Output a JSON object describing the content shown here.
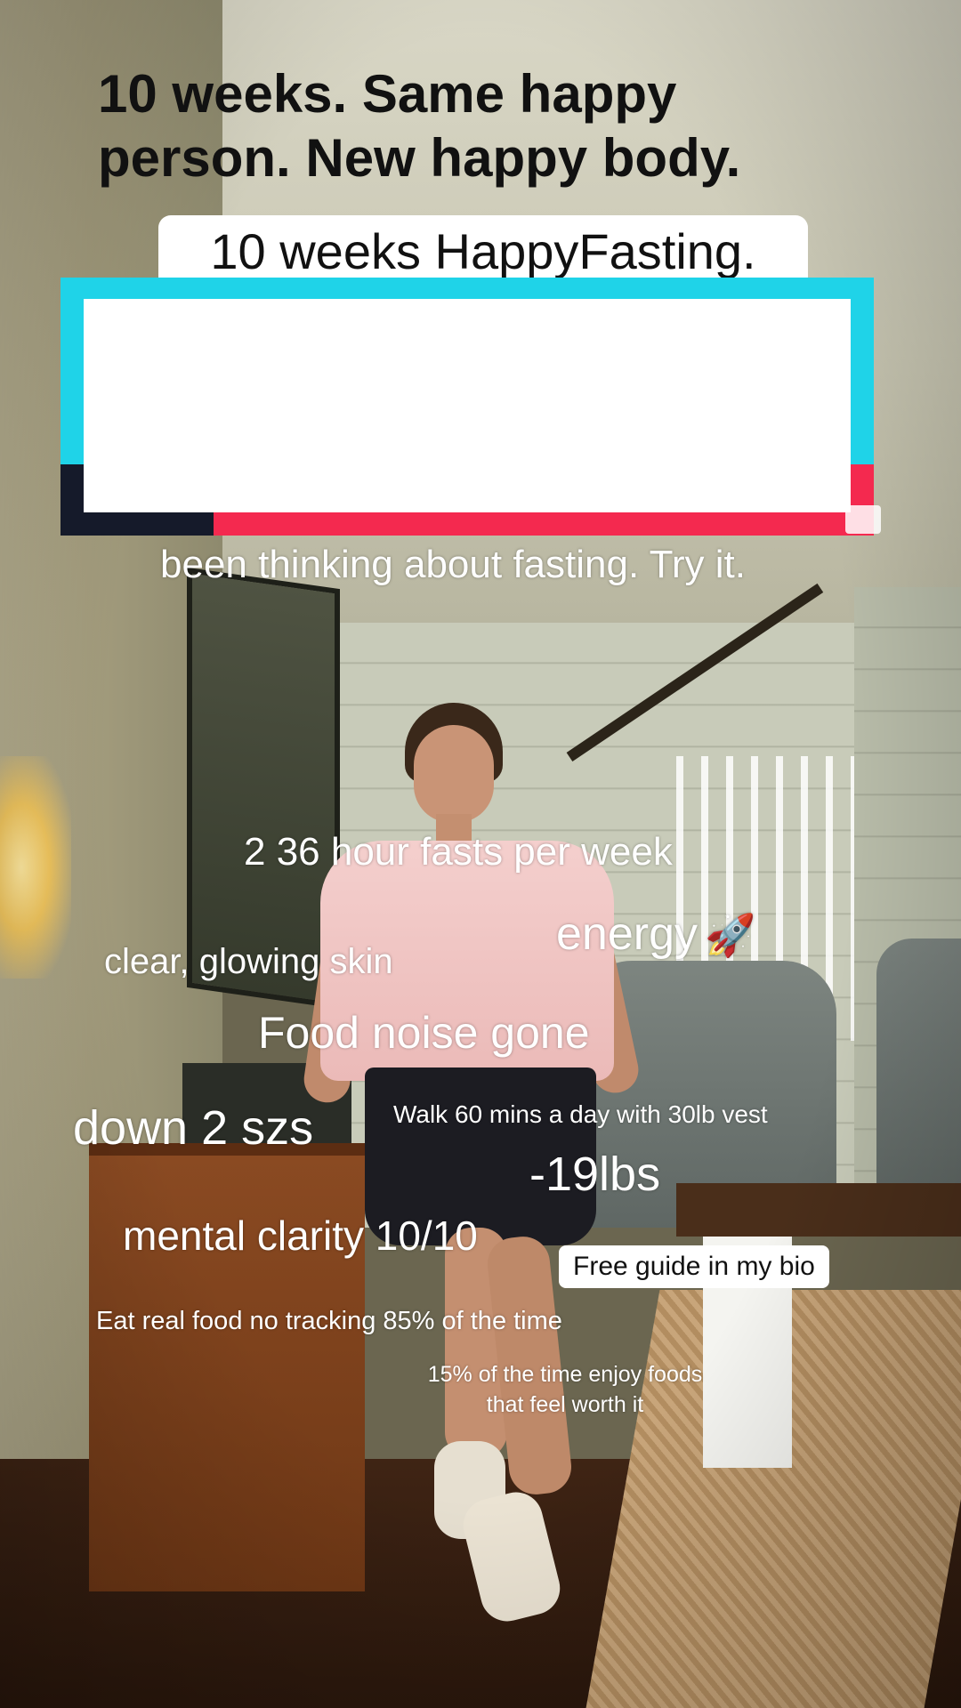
{
  "video": {
    "top_caption": "10 weeks HappyFasting.",
    "headline": "10 weeks. Same happy person. New happy body.",
    "subcaption": "been thinking about fasting. Try it.",
    "colors": {
      "headline_cyan": "#1fd3e8",
      "headline_red": "#f4294f",
      "headline_navy": "#151a2a",
      "text_white": "#ffffff"
    }
  },
  "overlays": {
    "fasts": "2 36 hour fasts per week",
    "energy": "energy",
    "energy_emoji": "🚀",
    "skin": "clear, glowing skin",
    "food_noise": "Food noise gone",
    "sizes": "down 2 szs",
    "walk": "Walk 60 mins a day with 30lb vest",
    "weight": "-19lbs",
    "clarity": "mental clarity 10/10",
    "guide": "Free guide in my bio",
    "eat": "Eat real food no tracking 85% of the time",
    "enjoy": "15% of the time enjoy foods that feel worth it"
  }
}
